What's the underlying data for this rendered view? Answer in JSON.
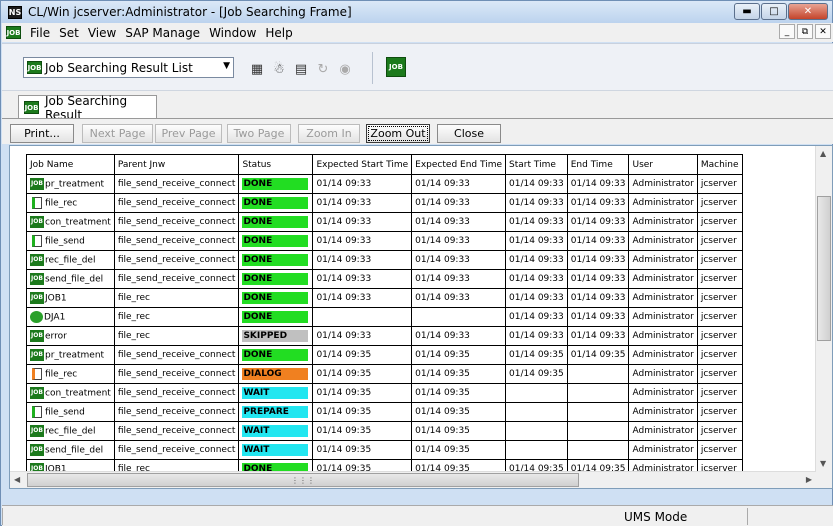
{
  "window": {
    "app_icon": "NS",
    "title": "CL/Win jcserver:Administrator - [Job Searching Frame]",
    "controls": [
      "minimize-icon",
      "maximize-icon",
      "close-icon"
    ]
  },
  "menubar": {
    "icon": "JOB",
    "items": [
      "File",
      "Set",
      "View",
      "SAP Manage",
      "Window",
      "Help"
    ],
    "mdi_controls": [
      "minimize-icon",
      "restore-icon",
      "close-icon"
    ]
  },
  "toolbar": {
    "combo_value": "Job Searching Result List",
    "icons": [
      "tree-view-icon",
      "search-person-icon",
      "list-icon",
      "refresh-icon",
      "binoculars-icon",
      "job-flow-icon"
    ]
  },
  "tab": {
    "label": "Job Searching Result"
  },
  "buttons": [
    {
      "label": "Print...",
      "enabled": true
    },
    {
      "label": "Next Page",
      "enabled": false
    },
    {
      "label": "Prev Page",
      "enabled": false
    },
    {
      "label": "Two Page",
      "enabled": false
    },
    {
      "label": "Zoom In",
      "enabled": false
    },
    {
      "label": "Zoom Out",
      "enabled": true
    },
    {
      "label": "Close",
      "enabled": true
    }
  ],
  "table": {
    "columns": [
      "Job Name",
      "Parent Jnw",
      "Status",
      "Expected Start Time",
      "Expected End Time",
      "Start Time",
      "End Time",
      "User",
      "Machine"
    ],
    "status_colors": {
      "DONE": "#22dd22",
      "SKIPPED": "#c0c0c0",
      "DIALOG": "#f08020",
      "WAIT": "#22e6f0",
      "PREPARE": "#22e6f0"
    },
    "rows": [
      {
        "icon": "job",
        "name": "pr_treatment",
        "parent": "file_send_receive_connect",
        "status": "DONE",
        "exp_start": "01/14 09:33",
        "exp_end": "01/14 09:33",
        "start": "01/14 09:33",
        "end": "01/14 09:33",
        "user": "Administrator",
        "machine": "jcserver"
      },
      {
        "icon": "file-green",
        "name": "file_rec",
        "parent": "file_send_receive_connect",
        "status": "DONE",
        "exp_start": "01/14 09:33",
        "exp_end": "01/14 09:33",
        "start": "01/14 09:33",
        "end": "01/14 09:33",
        "user": "Administrator",
        "machine": "jcserver"
      },
      {
        "icon": "job",
        "name": "con_treatment",
        "parent": "file_send_receive_connect",
        "status": "DONE",
        "exp_start": "01/14 09:33",
        "exp_end": "01/14 09:33",
        "start": "01/14 09:33",
        "end": "01/14 09:33",
        "user": "Administrator",
        "machine": "jcserver"
      },
      {
        "icon": "file-green",
        "name": "file_send",
        "parent": "file_send_receive_connect",
        "status": "DONE",
        "exp_start": "01/14 09:33",
        "exp_end": "01/14 09:33",
        "start": "01/14 09:33",
        "end": "01/14 09:33",
        "user": "Administrator",
        "machine": "jcserver"
      },
      {
        "icon": "job",
        "name": "rec_file_del",
        "parent": "file_send_receive_connect",
        "status": "DONE",
        "exp_start": "01/14 09:33",
        "exp_end": "01/14 09:33",
        "start": "01/14 09:33",
        "end": "01/14 09:33",
        "user": "Administrator",
        "machine": "jcserver"
      },
      {
        "icon": "job",
        "name": "send_file_del",
        "parent": "file_send_receive_connect",
        "status": "DONE",
        "exp_start": "01/14 09:33",
        "exp_end": "01/14 09:33",
        "start": "01/14 09:33",
        "end": "01/14 09:33",
        "user": "Administrator",
        "machine": "jcserver"
      },
      {
        "icon": "job",
        "name": "JOB1",
        "parent": "file_rec",
        "status": "DONE",
        "exp_start": "01/14 09:33",
        "exp_end": "01/14 09:33",
        "start": "01/14 09:33",
        "end": "01/14 09:33",
        "user": "Administrator",
        "machine": "jcserver"
      },
      {
        "icon": "circle",
        "name": "DJA1",
        "parent": "file_rec",
        "status": "DONE",
        "exp_start": "",
        "exp_end": "",
        "start": "01/14 09:33",
        "end": "01/14 09:33",
        "user": "Administrator",
        "machine": "jcserver"
      },
      {
        "icon": "job",
        "name": "error",
        "parent": "file_rec",
        "status": "SKIPPED",
        "exp_start": "01/14 09:33",
        "exp_end": "01/14 09:33",
        "start": "01/14 09:33",
        "end": "01/14 09:33",
        "user": "Administrator",
        "machine": "jcserver"
      },
      {
        "icon": "job",
        "name": "pr_treatment",
        "parent": "file_send_receive_connect",
        "status": "DONE",
        "exp_start": "01/14 09:35",
        "exp_end": "01/14 09:35",
        "start": "01/14 09:35",
        "end": "01/14 09:35",
        "user": "Administrator",
        "machine": "jcserver"
      },
      {
        "icon": "file-orange",
        "name": "file_rec",
        "parent": "file_send_receive_connect",
        "status": "DIALOG",
        "exp_start": "01/14 09:35",
        "exp_end": "01/14 09:35",
        "start": "01/14 09:35",
        "end": "",
        "user": "Administrator",
        "machine": "jcserver"
      },
      {
        "icon": "job",
        "name": "con_treatment",
        "parent": "file_send_receive_connect",
        "status": "WAIT",
        "exp_start": "01/14 09:35",
        "exp_end": "01/14 09:35",
        "start": "",
        "end": "",
        "user": "Administrator",
        "machine": "jcserver"
      },
      {
        "icon": "file-green",
        "name": "file_send",
        "parent": "file_send_receive_connect",
        "status": "PREPARE",
        "exp_start": "01/14 09:35",
        "exp_end": "01/14 09:35",
        "start": "",
        "end": "",
        "user": "Administrator",
        "machine": "jcserver"
      },
      {
        "icon": "job",
        "name": "rec_file_del",
        "parent": "file_send_receive_connect",
        "status": "WAIT",
        "exp_start": "01/14 09:35",
        "exp_end": "01/14 09:35",
        "start": "",
        "end": "",
        "user": "Administrator",
        "machine": "jcserver"
      },
      {
        "icon": "job",
        "name": "send_file_del",
        "parent": "file_send_receive_connect",
        "status": "WAIT",
        "exp_start": "01/14 09:35",
        "exp_end": "01/14 09:35",
        "start": "",
        "end": "",
        "user": "Administrator",
        "machine": "jcserver"
      },
      {
        "icon": "job",
        "name": "JOB1",
        "parent": "file_rec",
        "status": "DONE",
        "exp_start": "01/14 09:35",
        "exp_end": "01/14 09:35",
        "start": "01/14 09:35",
        "end": "01/14 09:35",
        "user": "Administrator",
        "machine": "jcserver"
      }
    ]
  },
  "statusbar": {
    "mode": "UMS Mode"
  }
}
